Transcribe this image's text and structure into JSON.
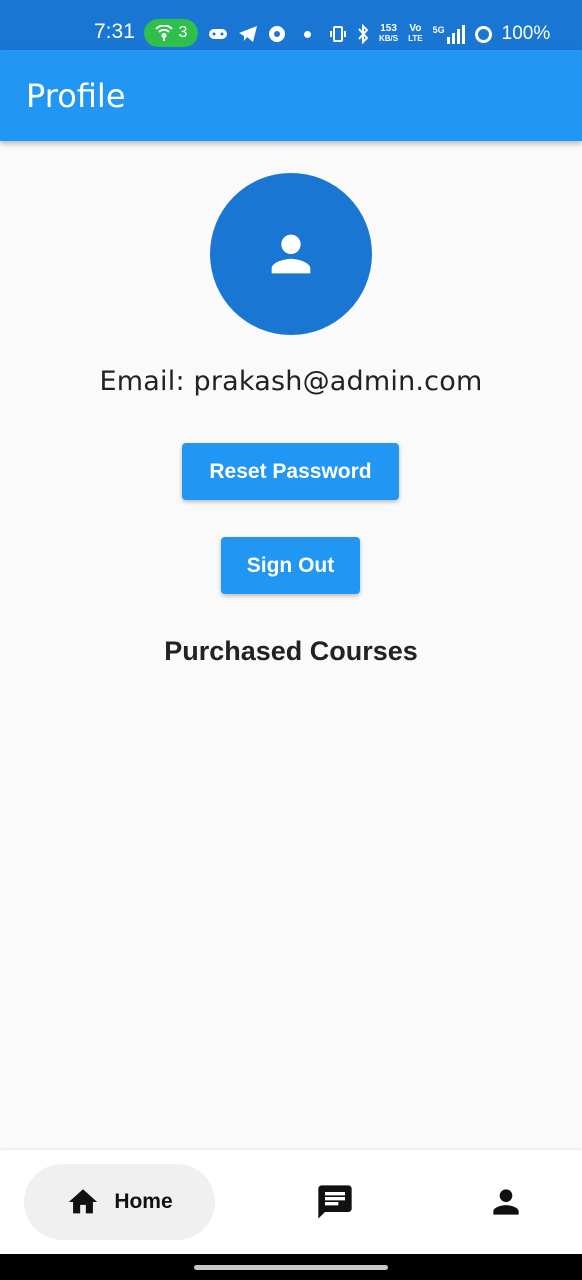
{
  "status_bar": {
    "time": "7:31",
    "hotspot_count": "3",
    "net_speed_top": "153",
    "net_speed_bottom": "KB/S",
    "volte_top": "Vo",
    "volte_bottom": "LTE",
    "network": "5G",
    "battery": "100%"
  },
  "app_bar": {
    "title": "Profile"
  },
  "profile": {
    "avatar_icon": "person-icon",
    "email_text": "Email: prakash@admin.com"
  },
  "actions": {
    "reset_label": "Reset Password",
    "signout_label": "Sign Out"
  },
  "courses": {
    "title": "Purchased Courses",
    "items": []
  },
  "bottom_nav": {
    "items": [
      {
        "label": "Home",
        "icon": "home-icon",
        "selected": true
      },
      {
        "label": "",
        "icon": "chat-icon",
        "selected": false
      },
      {
        "label": "",
        "icon": "person-icon",
        "selected": false
      }
    ]
  },
  "colors": {
    "primary": "#2196f3",
    "primary_dark": "#1976d2",
    "background": "#fafafa"
  }
}
